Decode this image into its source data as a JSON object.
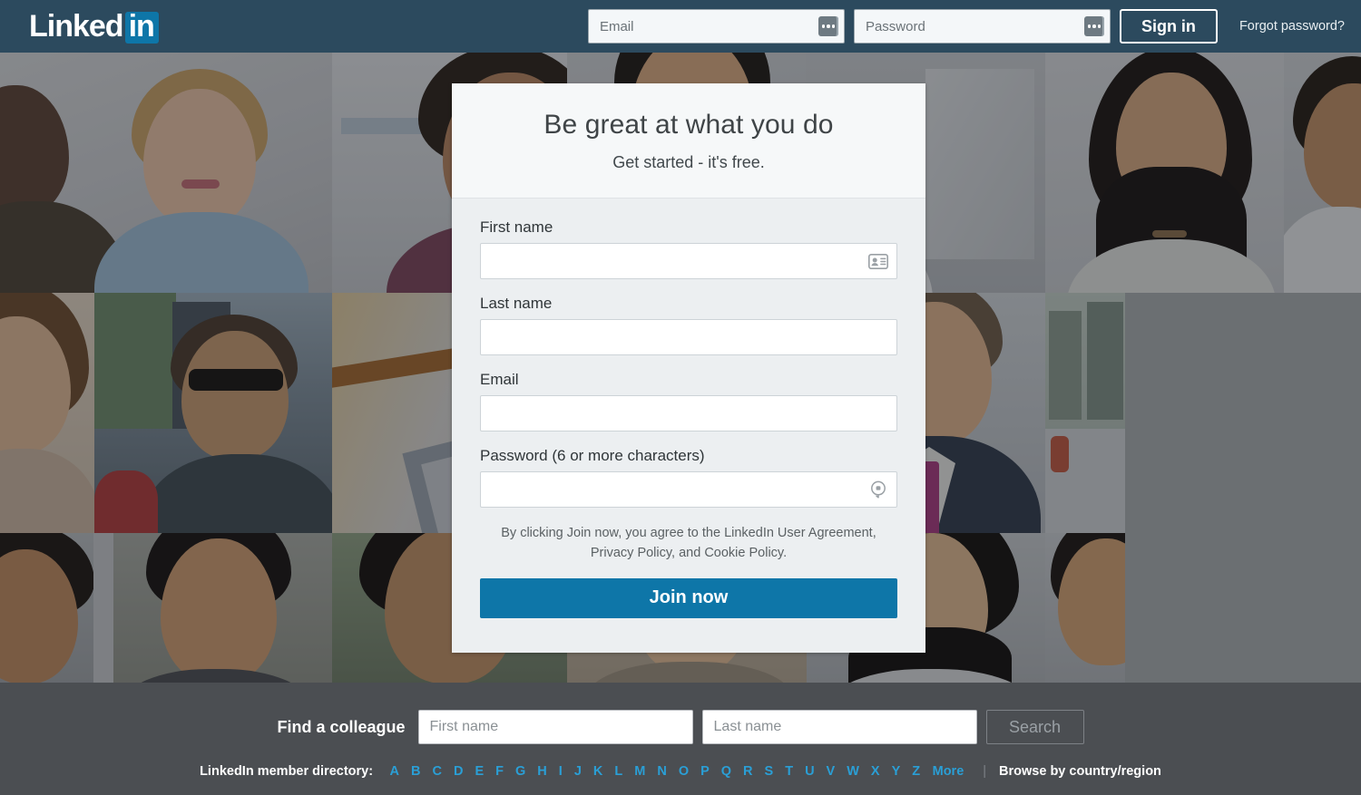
{
  "header": {
    "logo_text": "Linked",
    "logo_badge": "in",
    "email_placeholder": "Email",
    "email_value": "",
    "password_placeholder": "Password",
    "password_value": "",
    "signin_label": "Sign in",
    "forgot_label": "Forgot password?",
    "bg_color": "#2c4a5e",
    "autofill_icon": "autofill-dots-icon"
  },
  "signup": {
    "title": "Be great at what you do",
    "subtitle": "Get started - it's free.",
    "fields": [
      {
        "label": "First name",
        "value": "",
        "placeholder": "",
        "icon": "contact-card-icon"
      },
      {
        "label": "Last name",
        "value": "",
        "placeholder": "",
        "icon": ""
      },
      {
        "label": "Email",
        "value": "",
        "placeholder": "",
        "icon": ""
      },
      {
        "label": "Password (6 or more characters)",
        "value": "",
        "placeholder": "",
        "icon": "key-lock-icon"
      }
    ],
    "terms": "By clicking Join now, you agree to the LinkedIn User Agreement, Privacy Policy, and Cookie Policy.",
    "join_label": "Join now",
    "join_color": "#0e76a8"
  },
  "footer": {
    "find_label": "Find a colleague",
    "first_name_placeholder": "First name",
    "first_name_value": "",
    "last_name_placeholder": "Last name",
    "last_name_value": "",
    "search_label": "Search",
    "directory_label": "LinkedIn member directory:",
    "letters": [
      "A",
      "B",
      "C",
      "D",
      "E",
      "F",
      "G",
      "H",
      "I",
      "J",
      "K",
      "L",
      "M",
      "N",
      "O",
      "P",
      "Q",
      "R",
      "S",
      "T",
      "U",
      "V",
      "W",
      "X",
      "Y",
      "Z"
    ],
    "more_label": "More",
    "separator": "|",
    "browse_label": "Browse by country/region",
    "link_color": "#2a9fd6",
    "bg_color": "#4b4e52"
  },
  "background": {
    "type": "photo-collage",
    "description": "Darkened grid of smiling professional portrait photographs",
    "rows": 3,
    "overlay_color": "rgba(24,26,30,0.42)"
  }
}
